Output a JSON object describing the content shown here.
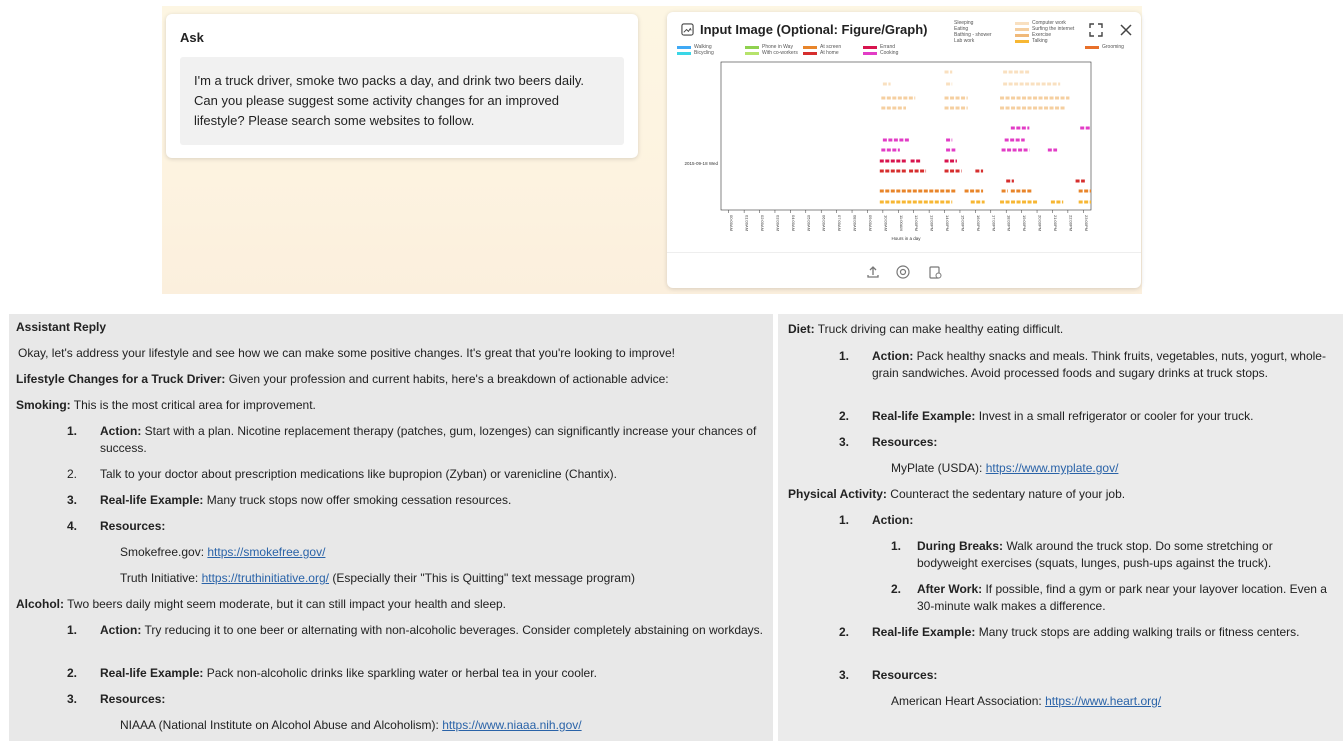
{
  "ask": {
    "title": "Ask",
    "question": "I'm a truck driver, smoke two packs a day, and drink two beers daily. Can you please suggest some activity changes for an improved lifestyle? Please search some websites to follow."
  },
  "image_panel": {
    "title": "Input Image (Optional: Figure/Graph)",
    "icons": [
      "image-frame-icon",
      "fullscreen-icon",
      "close-icon",
      "upload-icon",
      "camera-icon",
      "clipboard-icon"
    ],
    "chart_legend": [
      "Walking",
      "Bicycling",
      "Phone in Way",
      "With co-workers",
      "At screen",
      "At home",
      "Errand",
      "Cooking",
      "Sleeping",
      "Eating",
      "Bathing - shower",
      "Lab work",
      "Computer work",
      "Surfing the internet",
      "Exercise",
      "Talking",
      "Grooming"
    ],
    "chart_ytick": "2015-09-18 Wed",
    "chart_xlabel": "Hours in a day",
    "chart_xticks": [
      "00:00AM",
      "01:00AM",
      "02:00AM",
      "03:00AM",
      "04:00AM",
      "05:00AM",
      "06:00AM",
      "07:00AM",
      "08:00AM",
      "09:00AM",
      "10:00AM",
      "11:00AM",
      "12:00PM",
      "13:00PM",
      "14:00PM",
      "15:00PM",
      "16:00PM",
      "17:00PM",
      "18:00PM",
      "19:00PM",
      "20:00PM",
      "21:00PM",
      "22:00PM",
      "23:00PM"
    ]
  },
  "reply": {
    "heading": "Assistant Reply",
    "intro": "Okay, let's address your lifestyle and see how we can make some positive changes. It's great that you're looking to improve!",
    "lifestyle_label": "Lifestyle Changes for a Truck Driver:",
    "lifestyle_text": " Given your profession and current habits, here's a breakdown of actionable advice:",
    "smoking_label": "Smoking:",
    "smoking_text": " This is the most critical area for improvement.",
    "smoking_items": {
      "n1": "1.",
      "n2": "2.",
      "n3": "3.",
      "n4": "4.",
      "action_label": "Action:",
      "action_text": " Start with a plan. Nicotine replacement therapy (patches, gum, lozenges) can significantly increase your chances of success.",
      "item2": "Talk to your doctor about prescription medications like bupropion (Zyban) or varenicline (Chantix).",
      "example_label": "Real-life Example:",
      "example_text": " Many truck stops now offer smoking cessation resources.",
      "resources_label": "Resources:",
      "res1_name": "Smokefree.gov: ",
      "res1_link": "https://smokefree.gov/",
      "res2_name": "Truth Initiative: ",
      "res2_link": "https://truthinitiative.org/",
      "res2_note": " (Especially their \"This is Quitting\" text message program)"
    },
    "alcohol_label": "Alcohol:",
    "alcohol_text": " Two beers daily might seem moderate, but it can still impact your health and sleep.",
    "alcohol_items": {
      "n1": "1.",
      "n2": "2.",
      "n3": "3.",
      "action_label": "Action:",
      "action_text": " Try reducing it to one beer or alternating with non-alcoholic beverages. Consider completely abstaining on workdays.",
      "example_label": "Real-life Example:",
      "example_text": " Pack non-alcoholic drinks like sparkling water or herbal tea in your cooler.",
      "resources_label": "Resources:",
      "res1_name": "NIAAA (National Institute on Alcohol Abuse and Alcoholism): ",
      "res1_link": "https://www.niaaa.nih.gov/"
    },
    "diet_label": "Diet:",
    "diet_text": " Truck driving can make healthy eating difficult.",
    "diet_items": {
      "n1": "1.",
      "n2": "2.",
      "n3": "3.",
      "action_label": "Action:",
      "action_text": " Pack healthy snacks and meals. Think fruits, vegetables, nuts, yogurt, whole-grain sandwiches. Avoid processed foods and sugary drinks at truck stops.",
      "example_label": "Real-life Example:",
      "example_text": " Invest in a small refrigerator or cooler for your truck.",
      "resources_label": "Resources:",
      "res1_name": "MyPlate (USDA): ",
      "res1_link": "https://www.myplate.gov/"
    },
    "activity_label": "Physical Activity:",
    "activity_text": " Counteract the sedentary nature of your job.",
    "activity_items": {
      "n1": "1.",
      "n2": "2.",
      "n3": "3.",
      "action_label": "Action:",
      "sub_n1": "1.",
      "sub_n2": "2.",
      "breaks_label": "During Breaks:",
      "breaks_text": " Walk around the truck stop. Do some stretching or bodyweight exercises (squats, lunges, push-ups against the truck).",
      "afterwork_label": "After Work:",
      "afterwork_text": " If possible, find a gym or park near your layover location. Even a 30-minute walk makes a difference.",
      "example_label": "Real-life Example:",
      "example_text": " Many truck stops are adding walking trails or fitness centers.",
      "resources_label": "Resources:",
      "res1_name": "American Heart Association: ",
      "res1_link": "https://www.heart.org/"
    }
  }
}
